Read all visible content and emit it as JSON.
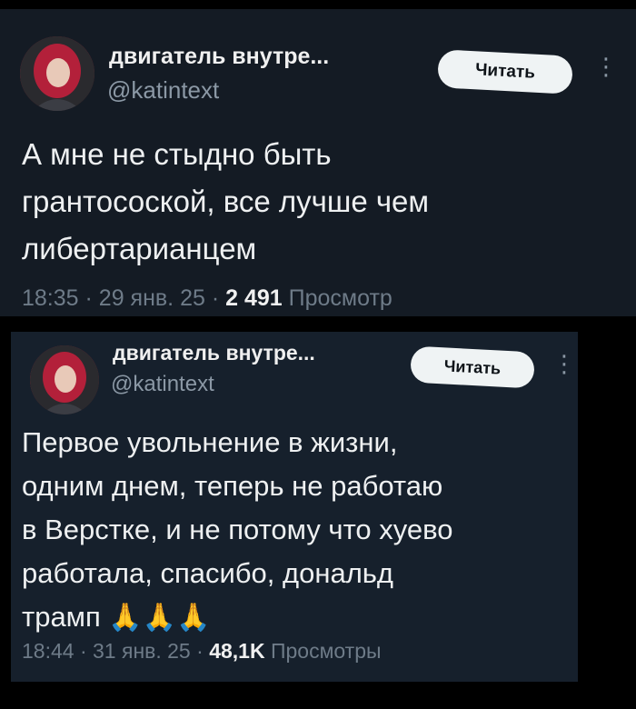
{
  "tweets": [
    {
      "author_name": "двигатель внутре...",
      "handle": "@katintext",
      "follow_label": "Читать",
      "more_icon": "more-vertical-icon",
      "text": "А мне не стыдно быть\nгрантосоской, все лучше чем\nлибертарианцем",
      "time": "18:35",
      "date": "29 янв. 25",
      "views_count": "2 491",
      "views_label": "Просмотр"
    },
    {
      "author_name": "двигатель внутре...",
      "handle": "@katintext",
      "follow_label": "Читать",
      "more_icon": "more-vertical-icon",
      "text": "Первое увольнение в жизни,\nодним днем, теперь не работаю\nв Верстке, и не потому что хуево\nработала, спасибо, дональд\nтрамп",
      "emoji": "🙏🙏🙏",
      "time": "18:44",
      "date": "31 янв. 25",
      "views_count": "48,1K",
      "views_label": "Просмотры"
    }
  ],
  "colors": {
    "background": "#000000",
    "tweet_background": "#15202b",
    "text_primary": "#e7e9ea",
    "text_secondary": "#8b98a5",
    "button_background": "#eff3f4"
  }
}
